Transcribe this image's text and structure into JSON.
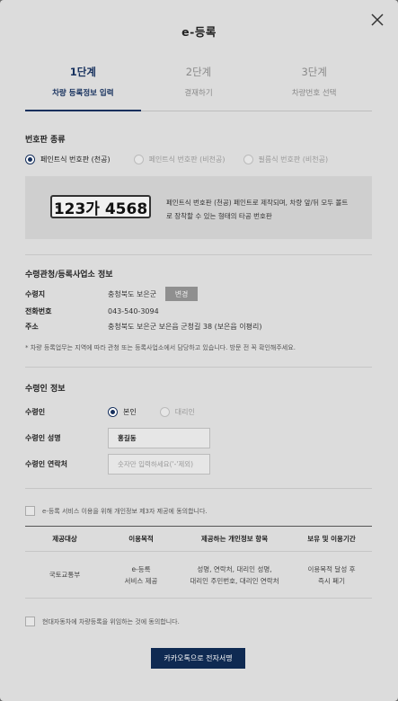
{
  "modal": {
    "title": "e-등록"
  },
  "steps": [
    {
      "num": "1단계",
      "label": "차량 등록정보 입력",
      "active": true
    },
    {
      "num": "2단계",
      "label": "결재하기",
      "active": false
    },
    {
      "num": "3단계",
      "label": "차량번호 선택",
      "active": false
    }
  ],
  "plate_type": {
    "section_title": "번호판 종류",
    "options": [
      {
        "label": "페인트식 번호판 (천공)",
        "selected": true
      },
      {
        "label": "페인트식 번호판 (비천공)",
        "selected": false
      },
      {
        "label": "필름식 번호판 (비천공)",
        "selected": false
      }
    ],
    "sample_plate": "123가 4568",
    "description": "페인트식 번호판 (천공) 페인트로 제작되며, 차량 앞/뒤 모두 볼트로 장착할 수 있는 형태의 타공 번호판"
  },
  "office": {
    "section_title": "수령관청/등록사업소 정보",
    "receive_label": "수령지",
    "receive_value": "충청북도 보은군",
    "change_button": "변경",
    "phone_label": "전화번호",
    "phone_value": "043-540-3094",
    "address_label": "주소",
    "address_value": "충청북도 보은군 보은읍 군청길 38 (보은읍 이평리)",
    "note": "* 차량 등록업무는 지역에 따라 관청 또는 등록사업소에서 담당하고 있습니다. 방문 전 꼭 확인해주세요."
  },
  "recipient": {
    "section_title": "수령인 정보",
    "type_label": "수령인",
    "type_options": [
      {
        "label": "본인",
        "selected": true
      },
      {
        "label": "대리인",
        "selected": false
      }
    ],
    "name_label": "수령인 성명",
    "name_value": "홍길동",
    "contact_label": "수령인 연락처",
    "contact_placeholder": "숫자만 입력하세요('-'제외)"
  },
  "consent": {
    "third_party": "e-등록 서비스 이용을 위해 개인정보 제3자 제공에 동의합니다.",
    "table_headers": [
      "제공대상",
      "이용목적",
      "제공하는 개인정보 항목",
      "보유 및 이용기간"
    ],
    "table_row": {
      "target": "국토교통부",
      "purpose_1": "e-등록",
      "purpose_2": "서비스 제공",
      "items_1": "성명, 연락처, 대리인 성명,",
      "items_2": "대리인 주민번호, 대리인 연락처",
      "period_1": "이용목적 달성 후",
      "period_2": "즉시 폐기"
    },
    "delegate": "현대자동차에 차량등록을 위임하는 것에 동의합니다."
  },
  "submit_button": "카카오톡으로 전자서명",
  "colors": {
    "accent": "#16305d",
    "button": "#0f2a52",
    "overlay": "#dcdcdc"
  }
}
